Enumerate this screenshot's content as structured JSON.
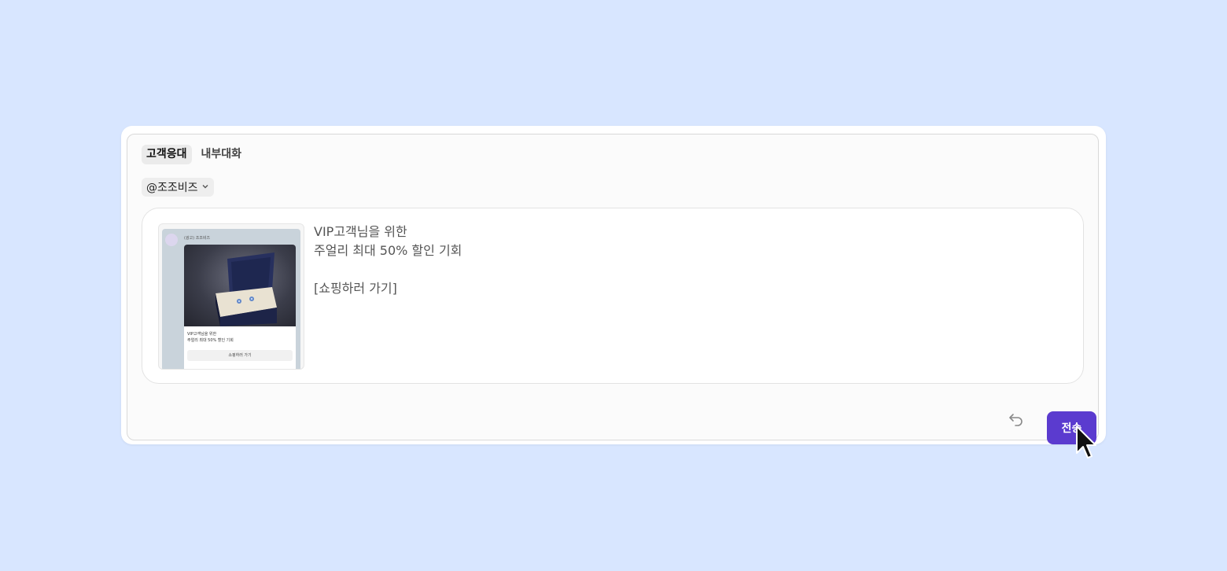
{
  "tabs": [
    {
      "label": "고객응대",
      "active": true
    },
    {
      "label": "내부대화",
      "active": false
    }
  ],
  "channel": {
    "label": "@조조비즈",
    "icon": "chevron-down-icon"
  },
  "message": {
    "lines": [
      "VIP고객님을 위한",
      "주얼리 최대 50% 할인 기회",
      "",
      "[쇼핑하러 가기]"
    ],
    "preview": {
      "sender": "(광고) 조조비즈",
      "card_line1": "VIP고객님을 위한",
      "card_line2": "주얼리 최대 50% 할인 기회",
      "button": "쇼핑하러 가기"
    }
  },
  "actions": {
    "undo_icon": "undo-icon",
    "send_label": "전송"
  },
  "colors": {
    "background": "#d8e6ff",
    "send_button": "#5b3bcf"
  }
}
